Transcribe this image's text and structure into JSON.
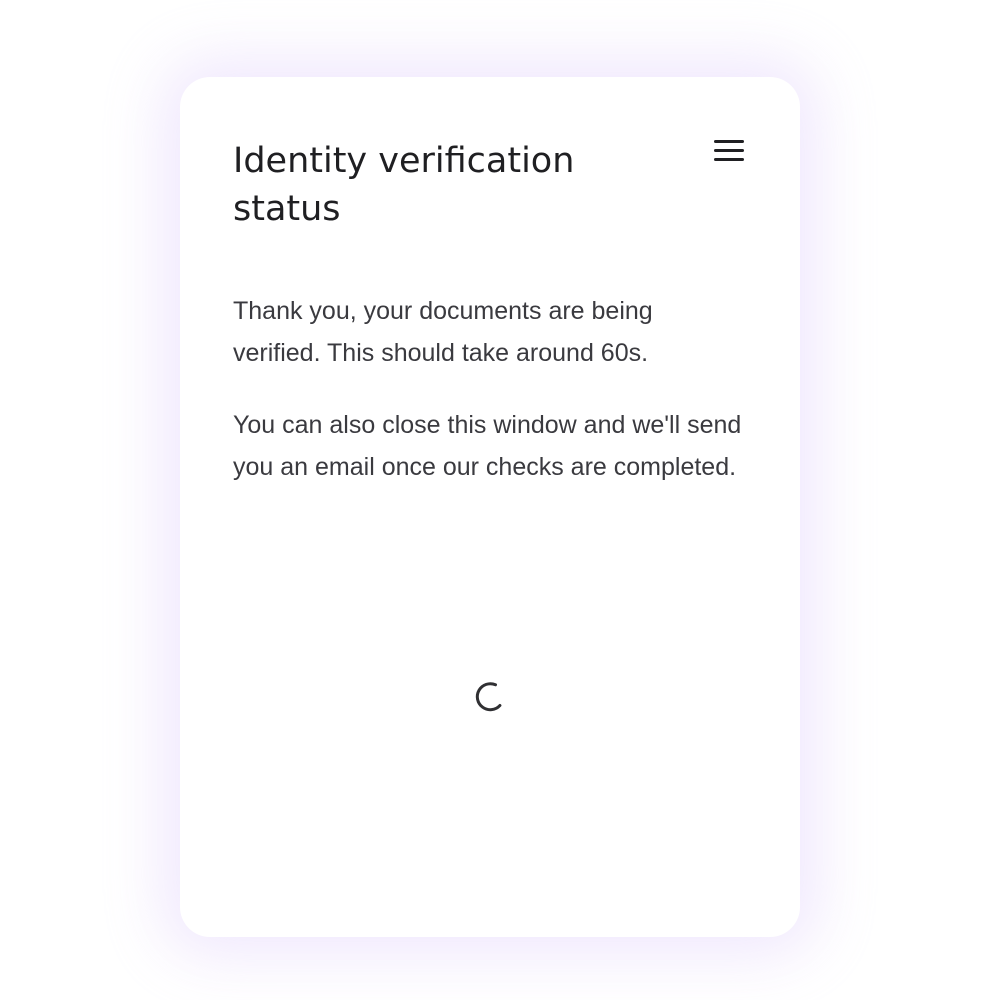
{
  "card": {
    "title": "Identity verification status",
    "paragraphs": [
      "Thank you, your documents are being verified. This should take around 60s.",
      "You can also close this window and we'll send you an email once our checks are completed."
    ]
  },
  "icons": {
    "menu": "hamburger-menu-icon",
    "loading": "loading-spinner-icon"
  },
  "colors": {
    "text_primary": "#1f1f22",
    "text_secondary": "#3a3a3f",
    "card_background": "#ffffff",
    "card_glow": "#e7dcfb"
  }
}
